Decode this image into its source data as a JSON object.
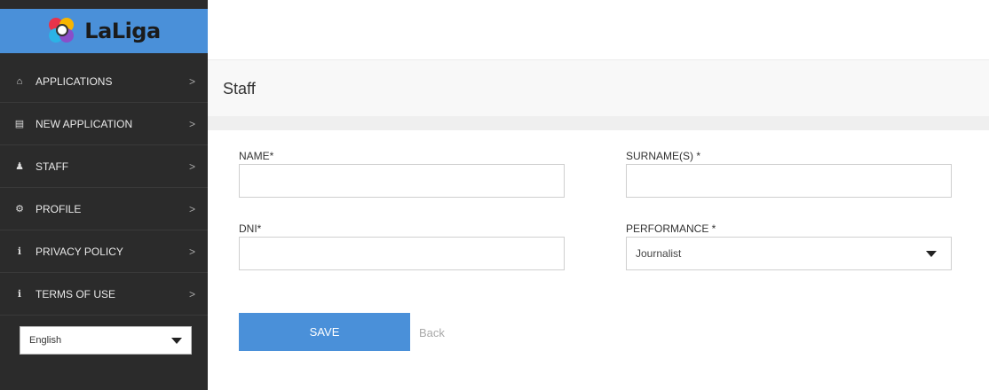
{
  "brand": {
    "logo_text": "LaLiga"
  },
  "sidebar": {
    "items": [
      {
        "label": "APPLICATIONS",
        "icon": "home-icon",
        "glyph": "⌂"
      },
      {
        "label": "NEW APPLICATION",
        "icon": "briefcase-icon",
        "glyph": "▤"
      },
      {
        "label": "STAFF",
        "icon": "user-plus-icon",
        "glyph": "♟"
      },
      {
        "label": "PROFILE",
        "icon": "gears-icon",
        "glyph": "⚙"
      },
      {
        "label": "PRIVACY POLICY",
        "icon": "info-circle-icon",
        "glyph": "ℹ"
      },
      {
        "label": "TERMS OF USE",
        "icon": "info-circle-icon",
        "glyph": "ℹ"
      }
    ],
    "chevron": ">",
    "language": {
      "selected": "English"
    }
  },
  "header": {
    "title": "Staff"
  },
  "form": {
    "name": {
      "label": "NAME*",
      "value": ""
    },
    "surname": {
      "label": "SURNAME(S) *",
      "value": ""
    },
    "dni": {
      "label": "DNI*",
      "value": ""
    },
    "performance": {
      "label": "PERFORMANCE *",
      "selected": "Journalist"
    },
    "save_label": "SAVE",
    "back_label": "Back"
  },
  "colors": {
    "accent": "#4a90d9",
    "sidebar_bg": "#2b2b2b",
    "header_bg": "#f8f8f8"
  }
}
